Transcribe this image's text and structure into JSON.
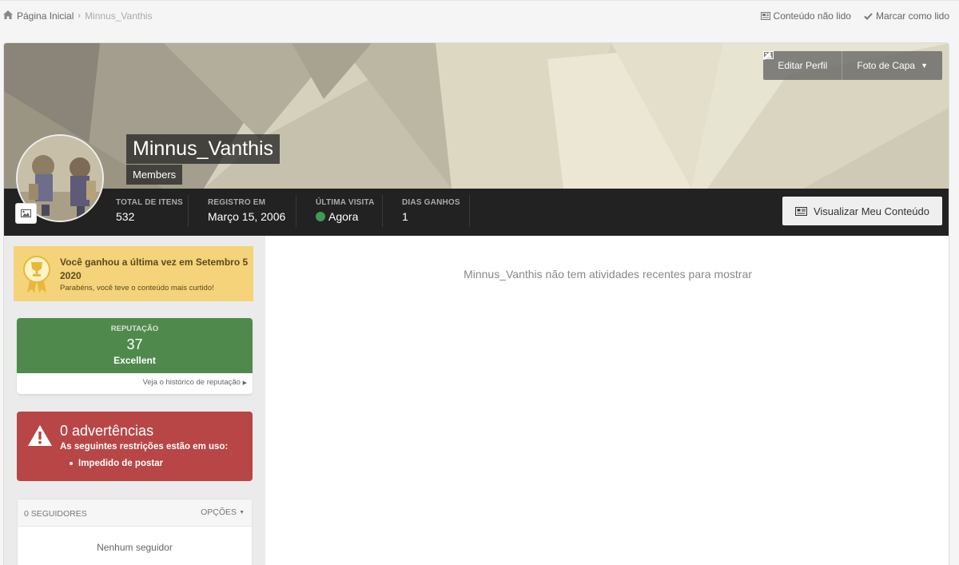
{
  "breadcrumb": {
    "home": "Página Inicial",
    "current": "Minnus_Vanthis"
  },
  "topbar": {
    "unread": "Conteúdo não lido",
    "mark_read": "Marcar como lido"
  },
  "cover": {
    "edit_profile": "Editar Perfil",
    "cover_photo": "Foto de Capa"
  },
  "profile": {
    "name": "Minnus_Vanthis",
    "group": "Members",
    "stats": [
      {
        "label": "TOTAL DE ITENS",
        "value": "532"
      },
      {
        "label": "REGISTRO EM",
        "value": "Março 15, 2006"
      },
      {
        "label": "ÚLTIMA VISITA",
        "value": "Agora"
      },
      {
        "label": "DIAS GANHOS",
        "value": "1"
      }
    ],
    "view_content": "Visualizar Meu Conteúdo"
  },
  "award": {
    "title": "Você ganhou a última vez em Setembro 5 2020",
    "subtitle": "Parabéns, você teve o conteúdo mais curtido!"
  },
  "reputation": {
    "label": "REPUTAÇÃO",
    "value": "37",
    "level": "Excellent",
    "history_link": "Veja o histórico de reputação"
  },
  "warnings": {
    "title": "0 advertências",
    "subtitle": "As seguintes restrições estão em uso:",
    "items": [
      "Impedido de postar"
    ]
  },
  "followers": {
    "count_label": "0 SEGUIDORES",
    "options": "OPÇÕES",
    "empty": "Nenhum seguidor"
  },
  "activity": {
    "empty": "Minnus_Vanthis não tem atividades recentes para mostrar"
  },
  "colors": {
    "stats_bar": "#222222",
    "reputation": "#4f8a4c",
    "warning": "#b84646",
    "award": "#f4d37b",
    "online": "#3e9a56"
  }
}
